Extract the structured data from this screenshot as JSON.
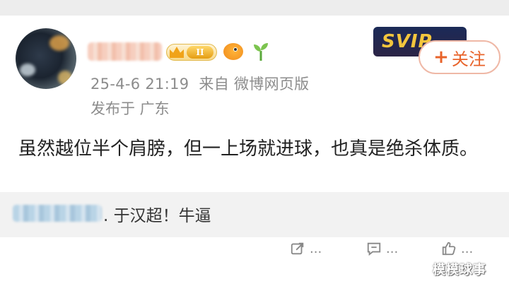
{
  "post": {
    "meta": {
      "timestamp": "25-4-6 21:19",
      "source": "来自 微博网页版",
      "location": "发布于 广东"
    },
    "vip_level": "II",
    "svip_label": "SVIP",
    "follow_button": {
      "plus": "+",
      "label": "关注"
    },
    "text": "虽然越位半个肩膀，但一上场就进球，也真是绝杀体质。"
  },
  "comment": {
    "text": ". 于汉超！牛逼"
  },
  "actions": {
    "share": "...",
    "comment": "...",
    "like": "..."
  },
  "watermark": "模模球事",
  "icons": [
    "crown-icon",
    "fish-emoji-icon",
    "sprout-icon",
    "share-icon",
    "comment-icon",
    "like-icon"
  ],
  "colors": {
    "accent": "#e8632a",
    "meta_text": "#8c8c8c",
    "comment_bg": "#f2f2f2"
  }
}
